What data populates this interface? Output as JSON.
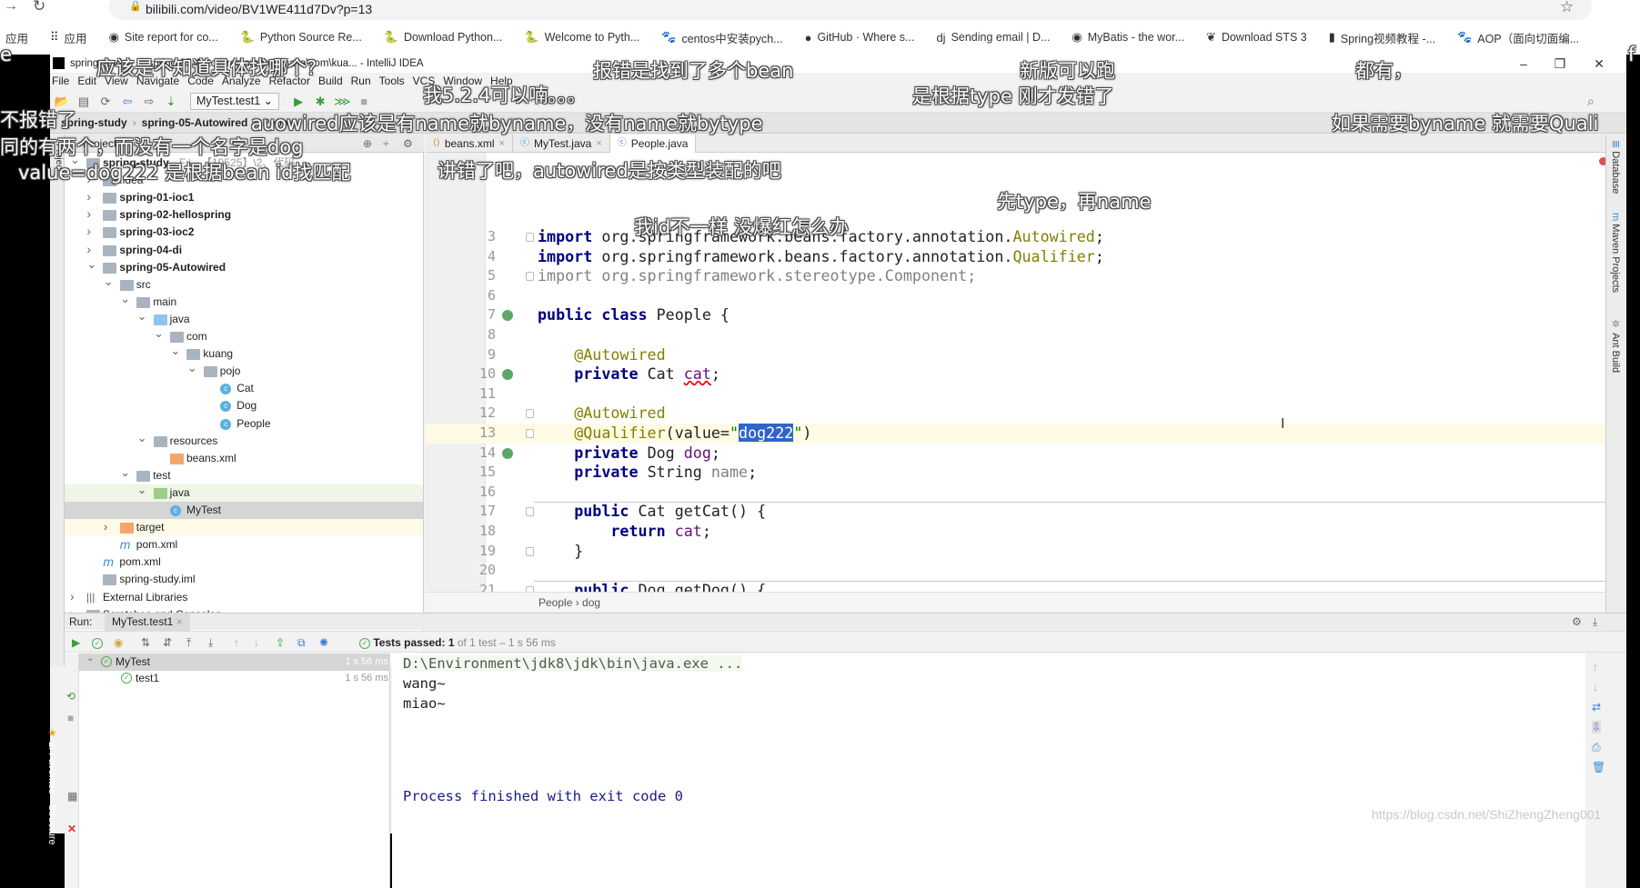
{
  "browser": {
    "url": "bilibili.com/video/BV1WE411d7Dv?p=13",
    "bookmarks": [
      {
        "label": "应用",
        "icon": "apps-icon"
      },
      {
        "label": "应用",
        "icon": "apps-grid-icon"
      },
      {
        "label": "Site report for co...",
        "icon": "globe-icon"
      },
      {
        "label": "Python Source Re...",
        "icon": "python-icon"
      },
      {
        "label": "Download Python...",
        "icon": "python-icon"
      },
      {
        "label": "Welcome to Pyth...",
        "icon": "python-icon"
      },
      {
        "label": "centos中安装pych...",
        "icon": "baidu-paw-icon"
      },
      {
        "label": "GitHub · Where s...",
        "icon": "github-icon"
      },
      {
        "label": "Sending email | D...",
        "icon": "django-icon"
      },
      {
        "label": "MyBatis - the wor...",
        "icon": "globe-icon"
      },
      {
        "label": "Download STS 3",
        "icon": "spring-icon"
      },
      {
        "label": "Spring视频教程 -...",
        "icon": "book-icon"
      },
      {
        "label": "AOP（面向切面编...",
        "icon": "baidu-paw-icon"
      }
    ]
  },
  "ide": {
    "title": "spring-study - ...\\spring-05-Autowired\\src\\main\\java\\com\\kua... - IntelliJ IDEA",
    "menu": [
      "File",
      "Edit",
      "View",
      "Navigate",
      "Code",
      "Analyze",
      "Refactor",
      "Build",
      "Run",
      "Tools",
      "VCS",
      "Window",
      "Help"
    ],
    "run_config": "MyTest.test1",
    "navbar": [
      "spring-study",
      "spring-05-Autowired",
      "People"
    ],
    "project_header": "Project",
    "tree": [
      {
        "label": "spring-study",
        "depth": 0,
        "chev": "v",
        "icon": "module",
        "bold": true,
        "hint": "F:\\...【19525】\\2、代码..."
      },
      {
        "label": ".idea",
        "depth": 1,
        "chev": ">",
        "icon": "folder"
      },
      {
        "label": "spring-01-ioc1",
        "depth": 1,
        "chev": ">",
        "icon": "module",
        "bold": true
      },
      {
        "label": "spring-02-hellospring",
        "depth": 1,
        "chev": ">",
        "icon": "module",
        "bold": true
      },
      {
        "label": "spring-03-ioc2",
        "depth": 1,
        "chev": ">",
        "icon": "module",
        "bold": true
      },
      {
        "label": "spring-04-di",
        "depth": 1,
        "chev": ">",
        "icon": "module",
        "bold": true
      },
      {
        "label": "spring-05-Autowired",
        "depth": 1,
        "chev": "v",
        "icon": "module",
        "bold": true
      },
      {
        "label": "src",
        "depth": 2,
        "chev": "v",
        "icon": "folder"
      },
      {
        "label": "main",
        "depth": 3,
        "chev": "v",
        "icon": "folder"
      },
      {
        "label": "java",
        "depth": 4,
        "chev": "v",
        "icon": "folder-blue"
      },
      {
        "label": "com",
        "depth": 5,
        "chev": "v",
        "icon": "package"
      },
      {
        "label": "kuang",
        "depth": 6,
        "chev": "v",
        "icon": "package"
      },
      {
        "label": "pojo",
        "depth": 7,
        "chev": "v",
        "icon": "package"
      },
      {
        "label": "Cat",
        "depth": 8,
        "chev": "",
        "icon": "class"
      },
      {
        "label": "Dog",
        "depth": 8,
        "chev": "",
        "icon": "class"
      },
      {
        "label": "People",
        "depth": 8,
        "chev": "",
        "icon": "class"
      },
      {
        "label": "resources",
        "depth": 4,
        "chev": "v",
        "icon": "folder"
      },
      {
        "label": "beans.xml",
        "depth": 5,
        "chev": "",
        "icon": "xml"
      },
      {
        "label": "test",
        "depth": 3,
        "chev": "v",
        "icon": "folder"
      },
      {
        "label": "java",
        "depth": 4,
        "chev": "v",
        "icon": "folder-green",
        "state": "green"
      },
      {
        "label": "MyTest",
        "depth": 5,
        "chev": "",
        "icon": "class",
        "state": "selected"
      },
      {
        "label": "target",
        "depth": 2,
        "chev": ">",
        "icon": "folder-orange",
        "state": "yellow"
      },
      {
        "label": "pom.xml",
        "depth": 2,
        "chev": "",
        "icon": "maven"
      },
      {
        "label": "pom.xml",
        "depth": 1,
        "chev": "",
        "icon": "maven"
      },
      {
        "label": "spring-study.iml",
        "depth": 1,
        "chev": "",
        "icon": "iml"
      },
      {
        "label": "External Libraries",
        "depth": 0,
        "chev": ">",
        "icon": "libraries"
      },
      {
        "label": "Scratches and Consoles",
        "depth": 0,
        "chev": ">",
        "icon": "scratches"
      }
    ],
    "tabs": [
      {
        "label": "beans.xml",
        "active": false
      },
      {
        "label": "MyTest.java",
        "active": false
      },
      {
        "label": "People.java",
        "active": true
      }
    ],
    "code": [
      {
        "n": 3,
        "fold": true,
        "t": [
          [
            "import ",
            "kw"
          ],
          [
            "org.springframework.beans.factory.annotation.",
            ""
          ],
          [
            "Autowired",
            "ann"
          ],
          [
            ";",
            ""
          ]
        ]
      },
      {
        "n": 4,
        "t": [
          [
            "import ",
            "kw"
          ],
          [
            "org.springframework.beans.factory.annotation.",
            ""
          ],
          [
            "Qualifier",
            "ann"
          ],
          [
            ";",
            ""
          ]
        ]
      },
      {
        "n": 5,
        "fold": true,
        "t": [
          [
            "import org.springframework.stereotype.Component;",
            "gr"
          ]
        ]
      },
      {
        "n": 6,
        "t": []
      },
      {
        "n": 7,
        "gicon": "bean-icon",
        "t": [
          [
            "public class ",
            "kw"
          ],
          [
            "People {",
            ""
          ]
        ]
      },
      {
        "n": 8,
        "t": []
      },
      {
        "n": 9,
        "t": [
          [
            "    ",
            ""
          ],
          [
            "@Autowired",
            "ann"
          ]
        ]
      },
      {
        "n": 10,
        "gicon": "autowired-icon",
        "t": [
          [
            "    ",
            ""
          ],
          [
            "private ",
            "kw"
          ],
          [
            "Cat ",
            ""
          ],
          [
            "cat",
            "fld err"
          ],
          [
            ";",
            ""
          ]
        ]
      },
      {
        "n": 11,
        "t": []
      },
      {
        "n": 12,
        "fold": true,
        "t": [
          [
            "    ",
            ""
          ],
          [
            "@Autowired",
            "ann"
          ]
        ]
      },
      {
        "n": 13,
        "fold": true,
        "current": true,
        "t": [
          [
            "    ",
            ""
          ],
          [
            "@Qualifier",
            "ann"
          ],
          [
            "(value=",
            ""
          ],
          [
            "\"",
            "str"
          ],
          [
            "dog222",
            "sel"
          ],
          [
            "\"",
            "str"
          ],
          [
            ")",
            ""
          ]
        ]
      },
      {
        "n": 14,
        "gicon": "autowired-icon",
        "t": [
          [
            "    ",
            ""
          ],
          [
            "private ",
            "kw"
          ],
          [
            "Dog ",
            ""
          ],
          [
            "dog",
            "fld"
          ],
          [
            ";",
            ""
          ]
        ]
      },
      {
        "n": 15,
        "t": [
          [
            "    ",
            ""
          ],
          [
            "private ",
            "kw"
          ],
          [
            "String ",
            ""
          ],
          [
            "name",
            "gr"
          ],
          [
            ";",
            ""
          ]
        ]
      },
      {
        "n": 16,
        "t": []
      },
      {
        "n": 17,
        "fold": true,
        "sep": true,
        "t": [
          [
            "    ",
            ""
          ],
          [
            "public ",
            "kw"
          ],
          [
            "Cat getCat() {",
            ""
          ]
        ]
      },
      {
        "n": 18,
        "t": [
          [
            "        ",
            ""
          ],
          [
            "return ",
            "kw"
          ],
          [
            "cat",
            "fld"
          ],
          [
            ";",
            ""
          ]
        ]
      },
      {
        "n": 19,
        "fold": true,
        "t": [
          [
            "    }",
            ""
          ]
        ]
      },
      {
        "n": 20,
        "t": []
      },
      {
        "n": 21,
        "fold": true,
        "sep": true,
        "t": [
          [
            "    ",
            ""
          ],
          [
            "public ",
            "kw"
          ],
          [
            "Dog getDog() {",
            ""
          ]
        ]
      },
      {
        "n": 22,
        "t": [
          [
            "        ",
            ""
          ],
          [
            "return ",
            "kw"
          ],
          [
            "dog",
            "fld"
          ],
          [
            ";",
            ""
          ]
        ]
      },
      {
        "n": 23,
        "fold": true,
        "t": [
          [
            "    }",
            ""
          ]
        ]
      }
    ],
    "breadcrumb": [
      "People",
      "dog"
    ],
    "right_tools": [
      "Database",
      "Maven Projects",
      "Ant Build"
    ],
    "left_tools": [
      "2: Favorites",
      "Structure"
    ],
    "run": {
      "label": "Run:",
      "tab": "MyTest.test1",
      "status_bold": "Tests passed: 1",
      "status_rest": " of 1 test – 1 s 56 ms",
      "tests": [
        {
          "name": "MyTest",
          "time": "1 s 56 ms",
          "depth": 0
        },
        {
          "name": "test1",
          "time": "1 s 56 ms",
          "depth": 1
        }
      ],
      "console": [
        {
          "text": "D:\\Environment\\jdk8\\jdk\\bin\\java.exe ...",
          "kind": "cmd"
        },
        {
          "text": "wang~",
          "kind": "out"
        },
        {
          "text": "miao~",
          "kind": "out"
        },
        {
          "text": "",
          "kind": "out"
        },
        {
          "text": "Process finished with exit code 0",
          "kind": "exit"
        }
      ]
    }
  },
  "subtitles": [
    "应该是不知道具体找哪个？",
    "报错是找到了多个bean",
    "新版可以跑",
    "都有，",
    "我5.2.4可以喃。。。",
    "是根据type   刚才发错了",
    "不报错了",
    "auowired应该是有name就byname，没有name就bytype",
    "如果需要byname 就需要Quali",
    "同的有两个，而没有一个名字是dog",
    "value=dog222 是根据bean id找匹配",
    "讲错了吧，autowired是按类型装配的吧",
    "先type，再name",
    "我id不一样 没爆红怎么办",
    "e",
    "f"
  ],
  "watermark": "https://blog.csdn.net/ShiZhengZheng001",
  "colors": {
    "keyword": "#000080",
    "annotation": "#808000",
    "field": "#660e7a",
    "string": "#008000",
    "selection": "#2f65ca",
    "current_line": "#fffae3",
    "pass": "#4caf50"
  }
}
